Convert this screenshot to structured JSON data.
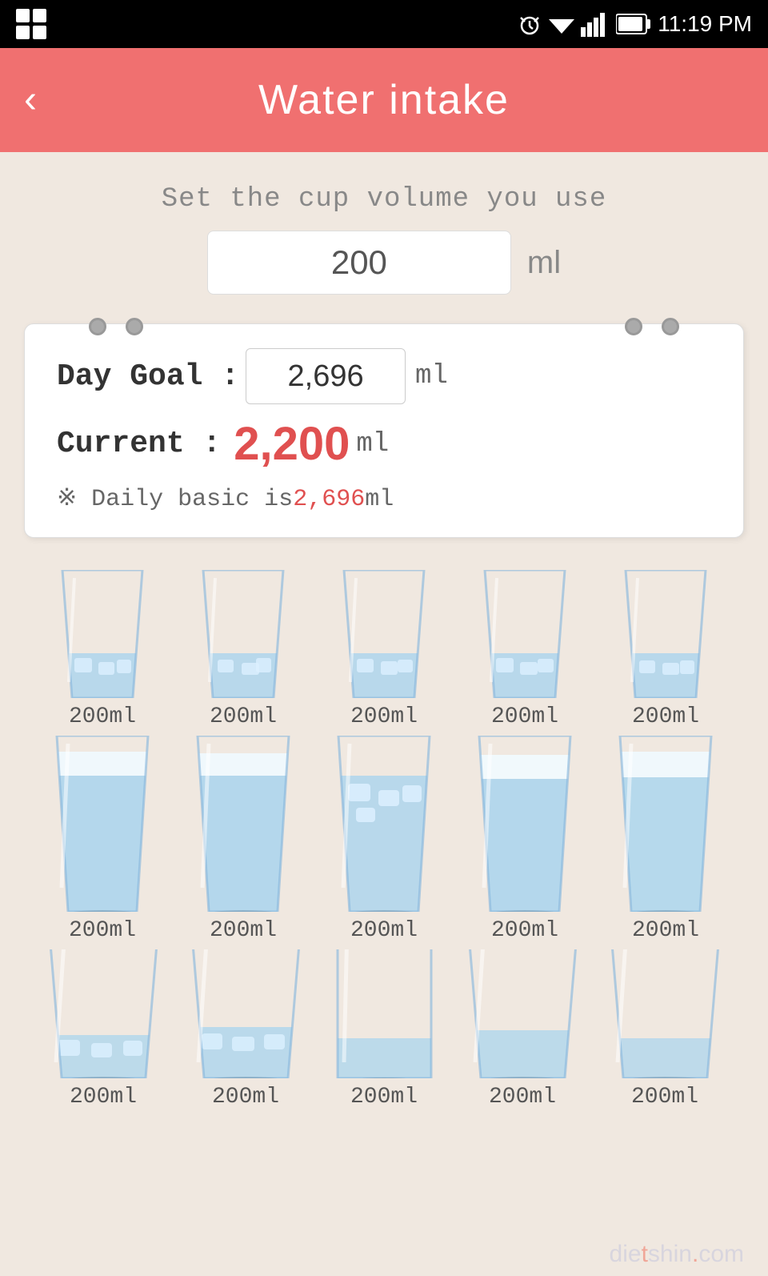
{
  "statusBar": {
    "time": "11:19 PM"
  },
  "header": {
    "backLabel": "‹",
    "title": "Water intake"
  },
  "cupVolume": {
    "label": "Set the cup volume you use",
    "value": "200",
    "unit": "ml"
  },
  "notepad": {
    "dayGoalLabel": "Day Goal :",
    "dayGoalValue": "2,696",
    "dayGoalUnit": "ml",
    "currentLabel": "Current :",
    "currentValue": "2,200",
    "currentUnit": "ml",
    "dailyBasicPrefix": "※ Daily basic is",
    "dailyBasicValue": "2,696",
    "dailyBasicSuffix": "ml"
  },
  "glasses": {
    "rows": [
      {
        "items": [
          {
            "label": "200ml",
            "fillLevel": 0.35,
            "type": "short"
          },
          {
            "label": "200ml",
            "fillLevel": 0.35,
            "type": "short"
          },
          {
            "label": "200ml",
            "fillLevel": 0.35,
            "type": "short"
          },
          {
            "label": "200ml",
            "fillLevel": 0.35,
            "type": "short"
          },
          {
            "label": "200ml",
            "fillLevel": 0.35,
            "type": "short"
          }
        ]
      },
      {
        "items": [
          {
            "label": "200ml",
            "fillLevel": 0.85,
            "type": "tall"
          },
          {
            "label": "200ml",
            "fillLevel": 0.82,
            "type": "tall"
          },
          {
            "label": "200ml",
            "fillLevel": 0.75,
            "type": "tall"
          },
          {
            "label": "200ml",
            "fillLevel": 0.8,
            "type": "tall"
          },
          {
            "label": "200ml",
            "fillLevel": 0.78,
            "type": "tall"
          }
        ]
      },
      {
        "items": [
          {
            "label": "200ml",
            "fillLevel": 0.3,
            "type": "wide"
          },
          {
            "label": "200ml",
            "fillLevel": 0.35,
            "type": "wide"
          },
          {
            "label": "200ml",
            "fillLevel": 0.25,
            "type": "wide-tall"
          },
          {
            "label": "200ml",
            "fillLevel": 0.35,
            "type": "wide"
          },
          {
            "label": "200ml",
            "fillLevel": 0.3,
            "type": "wide"
          }
        ]
      }
    ]
  }
}
